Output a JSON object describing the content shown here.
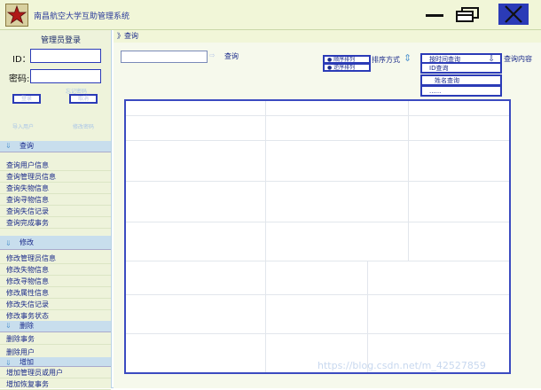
{
  "window": {
    "title": "南昌航空大学互助管理系统"
  },
  "login": {
    "title": "管理员登录",
    "id_label": "ID：",
    "password_label": "密码:",
    "login_button": "登录",
    "cancel_button": "取消",
    "forgot_link": "忘记密码",
    "import_link": "导入用户",
    "reset_link": "修改密码"
  },
  "sidebar": {
    "query_section": "查询",
    "query_items": [
      "查询用户信息",
      "查询管理员信息",
      "查询失物信息",
      "查询寻物信息",
      "查询失信记录",
      "查询完成事务"
    ],
    "modify_section": "修改",
    "modify_items": [
      "修改管理员信息",
      "修改失物信息",
      "修改寻物信息",
      "修改属性信息",
      "修改失信记录",
      "修改事务状态"
    ],
    "delete_section": "删除",
    "delete_items": [
      "删除事务",
      "删除用户"
    ],
    "add_section": "增加",
    "add_items": [
      "增加管理员或用户",
      "增加恢复事务"
    ]
  },
  "main": {
    "breadcrumb": "》查询",
    "search_link": "查询",
    "sort_options": [
      "顺序排列",
      "逆序排列"
    ],
    "sort_label": "排序方式",
    "dropdown_selected": "按时间查询",
    "dropdown_options": [
      "ID查询",
      "姓名查询",
      "......"
    ],
    "query_content_label": "查询内容"
  },
  "watermark": "https://blog.csdn.net/m_42527859",
  "colors": {
    "accent": "#2b3bb7",
    "sidebar_bg": "#eef3db",
    "header_bg": "#c8deed"
  }
}
